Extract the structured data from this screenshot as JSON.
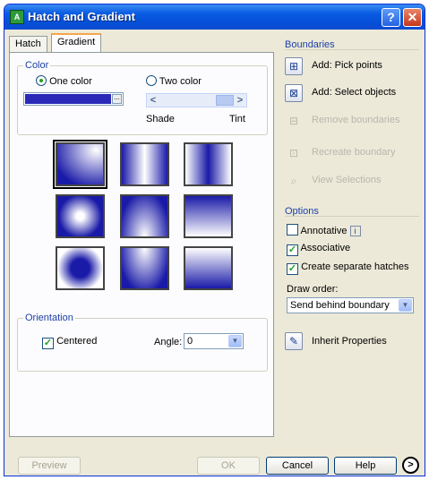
{
  "window": {
    "title": "Hatch and Gradient",
    "help_icon": "?",
    "close_icon": "x"
  },
  "tabs": [
    {
      "label": "Hatch"
    },
    {
      "label": "Gradient",
      "active": true
    }
  ],
  "color": {
    "group_label": "Color",
    "one_color": "One color",
    "two_color": "Two color",
    "selected": "One color",
    "swatch_color": "#2a2ab8",
    "shade_label": "Shade",
    "tint_label": "Tint",
    "slider_left": "<",
    "slider_right": ">"
  },
  "patterns": [
    "linear",
    "cylinder",
    "inv-cylinder",
    "spherical",
    "hemispherical",
    "curved",
    "inv-spherical",
    "inv-hemispherical",
    "inv-curved"
  ],
  "orientation": {
    "group_label": "Orientation",
    "centered_label": "Centered",
    "centered_checked": true,
    "angle_label": "Angle:",
    "angle_value": "0"
  },
  "boundaries": {
    "title": "Boundaries",
    "add_pick": "Add: Pick points",
    "add_select": "Add: Select objects",
    "remove": "Remove boundaries",
    "recreate": "Recreate boundary",
    "view": "View Selections"
  },
  "options": {
    "title": "Options",
    "annotative": "Annotative",
    "annotative_info": "i",
    "associative": "Associative",
    "separate": "Create separate hatches",
    "draw_order_label": "Draw order:",
    "draw_order_value": "Send behind boundary",
    "inherit": "Inherit Properties"
  },
  "buttons": {
    "preview": "Preview",
    "ok": "OK",
    "cancel": "Cancel",
    "help": "Help",
    "more": ">"
  },
  "colors": {
    "gradient_primary": "#1a1aa8",
    "title_bar": "#0a5de3"
  }
}
